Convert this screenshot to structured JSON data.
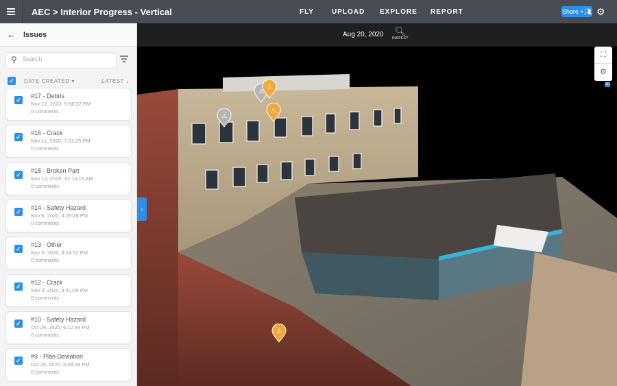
{
  "header": {
    "title": "AEC > Interior Progress - Vertical",
    "nav": [
      "FLY",
      "UPLOAD",
      "EXPLORE",
      "REPORT"
    ],
    "share_label": "Share",
    "share_icon": "add-people-icon",
    "settings_icon": "gear-icon"
  },
  "sidebar": {
    "title": "Issues",
    "search_placeholder": "Search",
    "sort_label": "DATE CREATED",
    "order_label": "LATEST",
    "issues": [
      {
        "title": "#17 - Debris",
        "date": "Nov 12, 2020, 5:56:22 PM",
        "comments": "0 comments"
      },
      {
        "title": "#16 - Crack",
        "date": "Nov 11, 2020, 7:31:25 PM",
        "comments": "0 comments"
      },
      {
        "title": "#15 - Broken Part",
        "date": "Nov 10, 2020, 12:14:15 AM",
        "comments": "0 comments"
      },
      {
        "title": "#14 - Safety Hazard",
        "date": "Nov 6, 2020, 4:29:28 PM",
        "comments": "0 comments"
      },
      {
        "title": "#13 - Other",
        "date": "Nov 5, 2020, 9:14:52 PM",
        "comments": "0 comments"
      },
      {
        "title": "#12 - Crack",
        "date": "Nov 3, 2020, 4:41:29 PM",
        "comments": "0 comments"
      },
      {
        "title": "#10 - Safety Hazard",
        "date": "Oct 29, 2020, 6:12:44 PM",
        "comments": "0 comments"
      },
      {
        "title": "#9 - Plan Deviation",
        "date": "Oct 29, 2020, 6:09:29 PM",
        "comments": "0 comments"
      }
    ]
  },
  "viewer": {
    "date": "Aug 20, 2020",
    "inspect_label": "INSPECT",
    "badge": "3D"
  },
  "colors": {
    "accent": "#2b8fe6",
    "topbar": "#484d55",
    "warning": "#f2a93b",
    "pin_gray": "#b5b5b5"
  }
}
